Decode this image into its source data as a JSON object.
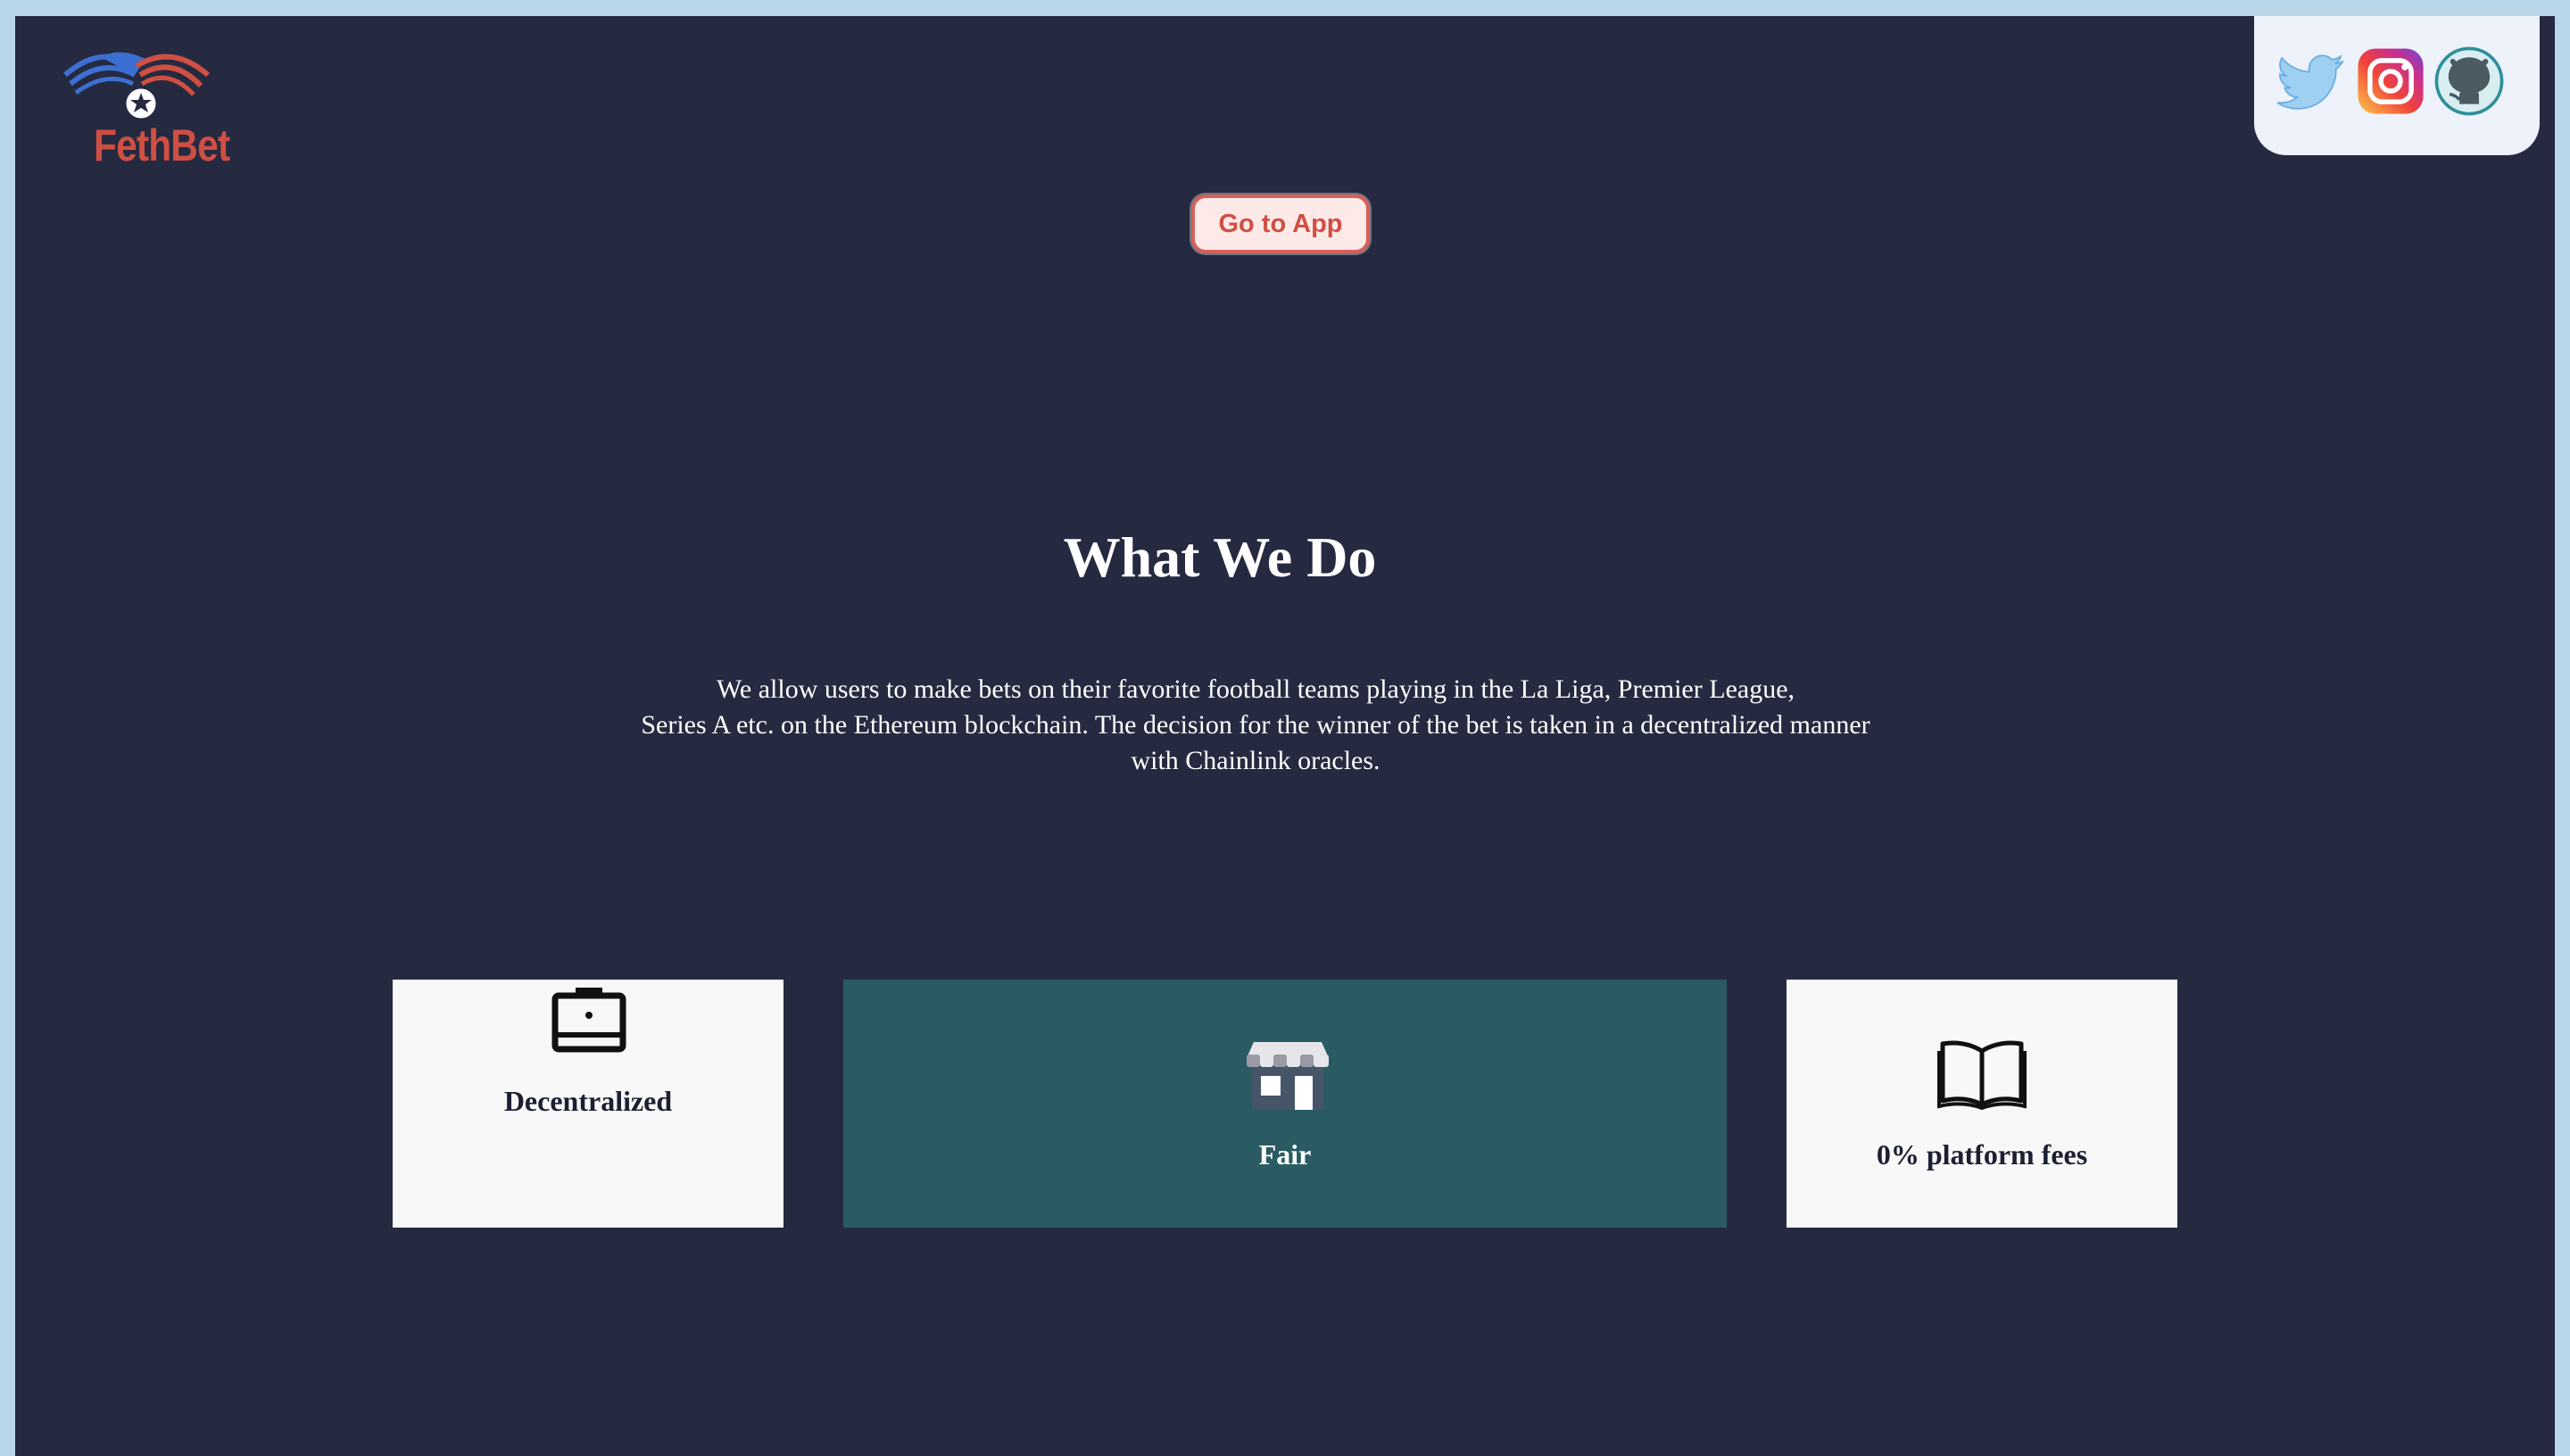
{
  "brand": {
    "name": "FethBet",
    "logo_icon": "eagle-star-logo",
    "colors": {
      "red": "#cf4f43",
      "blue": "#3c6fd1"
    }
  },
  "social": [
    {
      "name": "twitter",
      "icon": "twitter-icon"
    },
    {
      "name": "instagram",
      "icon": "instagram-icon"
    },
    {
      "name": "github",
      "icon": "github-icon"
    }
  ],
  "hero": {
    "cta_label": "Go to App"
  },
  "about": {
    "title": "What We Do",
    "description_lines": [
      "We allow users to make bets on their favorite football teams playing in the La Liga, Premier League,",
      "Series A etc. on the Ethereum blockchain. The decision for the winner of the bet is  taken in a decentralized manner",
      "with Chainlink oracles."
    ]
  },
  "features": [
    {
      "label": "Decentralized",
      "icon": "laptop-icon",
      "style": "white"
    },
    {
      "label": "Fair",
      "icon": "storefront-icon",
      "style": "teal"
    },
    {
      "label": "0% platform fees",
      "icon": "open-book-icon",
      "style": "white"
    }
  ],
  "theme": {
    "background": "#252a40",
    "frame": "#b9d6e8",
    "teal_card": "#2a5b62",
    "white_card": "#f8f8f8"
  }
}
